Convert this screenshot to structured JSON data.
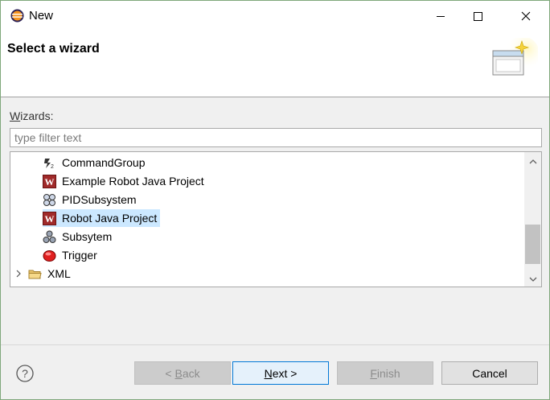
{
  "window": {
    "title": "New",
    "minimize_icon": "minimize-icon",
    "maximize_icon": "maximize-icon",
    "close_icon": "close-icon"
  },
  "header": {
    "title": "Select a wizard",
    "graphic_icon": "new-wizard-banner-icon"
  },
  "wizards": {
    "label_prefix": "W",
    "label_rest": "izards:",
    "filter_placeholder": "type filter text",
    "filter_value": ""
  },
  "tree": {
    "items": [
      {
        "label": "CommandGroup",
        "icon": "command-group-icon",
        "selected": false
      },
      {
        "label": "Example Robot Java Project",
        "icon": "wpilib-w-icon",
        "selected": false
      },
      {
        "label": "PIDSubsystem",
        "icon": "pid-subsystem-icon",
        "selected": false
      },
      {
        "label": "Robot Java Project",
        "icon": "wpilib-w-icon",
        "selected": true
      },
      {
        "label": "Subsytem",
        "icon": "subsystem-icon",
        "selected": false
      },
      {
        "label": "Trigger",
        "icon": "trigger-icon",
        "selected": false
      },
      {
        "label": "XML",
        "icon": "folder-icon",
        "selected": false,
        "collapsed": true
      }
    ],
    "scroll_position": 0.75
  },
  "footer": {
    "back_prefix": "< ",
    "back_mnemonic": "B",
    "back_rest": "ack",
    "next_mnemonic": "N",
    "next_rest": "ext >",
    "finish_mnemonic": "F",
    "finish_rest": "inish",
    "cancel_label": "Cancel",
    "help_icon": "help-icon"
  },
  "colors": {
    "selection": "#cce8ff",
    "default_button_border": "#0078d7",
    "wpilib_red": "#a02a2a"
  }
}
